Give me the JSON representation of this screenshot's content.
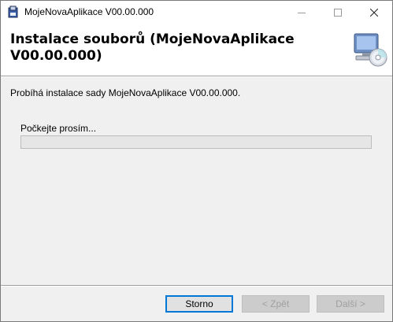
{
  "window": {
    "title": "MojeNovaAplikace V00.00.000",
    "icons": {
      "app": "installer-icon",
      "minimize": "minimize-icon",
      "maximize": "maximize-icon",
      "close": "close-icon"
    }
  },
  "banner": {
    "title": "Instalace souborů (MojeNovaAplikace V00.00.000)",
    "icon": "computer-cd-icon"
  },
  "status": {
    "text": "Probíhá instalace sady MojeNovaAplikace V00.00.000.",
    "wait_label": "Počkejte prosím...",
    "progress": 0
  },
  "buttons": {
    "cancel": "Storno",
    "back": "< Zpět",
    "next": "Další >"
  },
  "colors": {
    "accent": "#0078d7",
    "progress": "#06b025",
    "background": "#f0f0f0"
  }
}
